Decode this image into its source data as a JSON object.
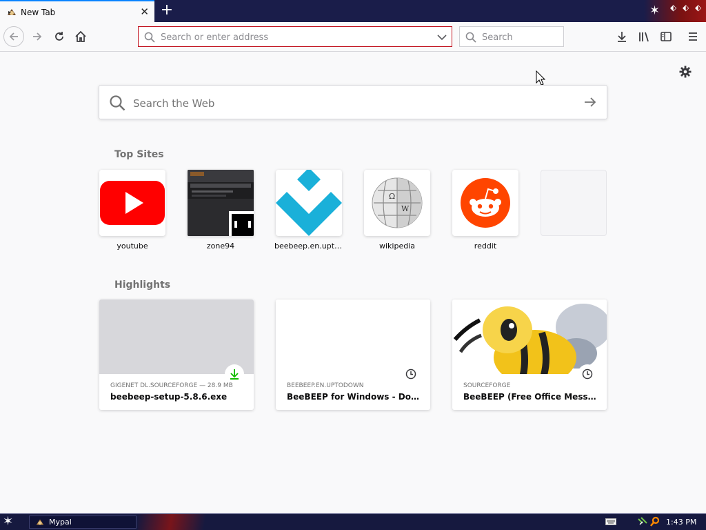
{
  "tab": {
    "title": "New Tab",
    "favicon": "mypal-icon"
  },
  "navbar": {
    "url_placeholder": "Search or enter address",
    "search_placeholder": "Search"
  },
  "newtab_page": {
    "websearch_placeholder": "Search the Web",
    "top_sites_title": "Top Sites",
    "top_sites": [
      {
        "label": "youtube",
        "icon": "youtube-logo"
      },
      {
        "label": "zone94",
        "icon": "zone94-thumbnail"
      },
      {
        "label": "beebeep.en.upto...",
        "icon": "beebeep-logo"
      },
      {
        "label": "wikipedia",
        "icon": "wikipedia-logo"
      },
      {
        "label": "reddit",
        "icon": "reddit-logo"
      },
      {
        "label": "",
        "icon": "empty-tile"
      }
    ],
    "highlights_title": "Highlights",
    "highlights": [
      {
        "source": "GIGENET DL.SOURCEFORGE — 28.9 MB",
        "title": "beebeep-setup-5.8.6.exe",
        "badge": "download-icon"
      },
      {
        "source": "BEEBEEP.EN.UPTODOWN",
        "title": "BeeBEEP for Windows - Downlo...",
        "badge": "clock-icon"
      },
      {
        "source": "SOURCEFORGE",
        "title": "BeeBEEP (Free Office Messenge...",
        "badge": "clock-icon"
      }
    ]
  },
  "taskbar": {
    "app_label": "Mypal",
    "clock": "1:43 PM"
  },
  "colors": {
    "accent": "#0a84ff",
    "urlbar_border": "#c1121f",
    "taskbar": "#16193f",
    "youtube": "#ff0000",
    "reddit": "#ff4500",
    "beebeep": "#1ab0d9"
  }
}
